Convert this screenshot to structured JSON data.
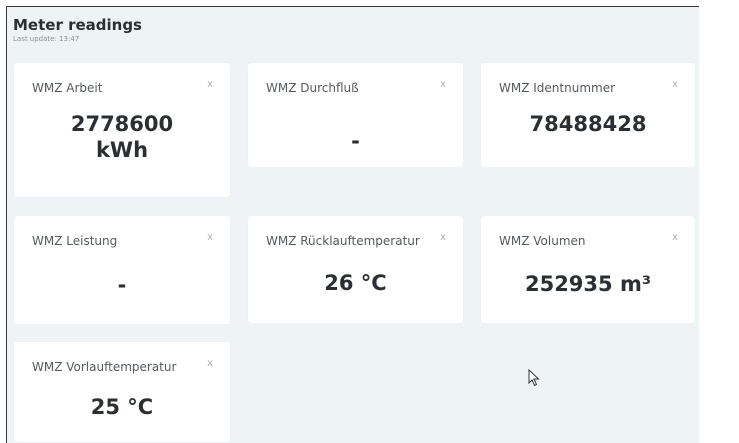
{
  "header": {
    "title": "Meter readings",
    "subtitle": "Last update: 13:47"
  },
  "cards": [
    {
      "title": "WMZ Arbeit",
      "value_line1": "2778600",
      "value_line2": "kWh",
      "close": "x"
    },
    {
      "title": "WMZ Durchfluß",
      "value": "-",
      "close": "x"
    },
    {
      "title": "WMZ Identnummer",
      "value": "78488428",
      "close": "x"
    },
    {
      "title": "WMZ Leistung",
      "value": "-",
      "close": "x"
    },
    {
      "title": "WMZ Rücklauftemperatur",
      "value": "26 °C",
      "close": "x"
    },
    {
      "title": "WMZ Volumen",
      "value": "252935 m³",
      "close": "x"
    },
    {
      "title": "WMZ Vorlauftemperatur",
      "value": "25 °C",
      "close": "x"
    }
  ]
}
